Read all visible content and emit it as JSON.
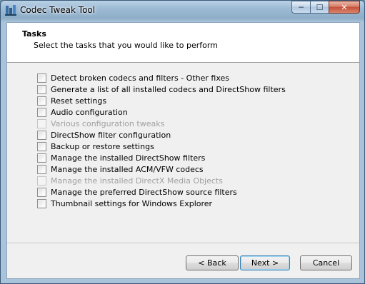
{
  "window": {
    "title": "Codec Tweak Tool",
    "minimize_glyph": "─",
    "maximize_glyph": "☐",
    "close_glyph": "✕"
  },
  "header": {
    "title": "Tasks",
    "subtitle": "Select the tasks that you would like to perform"
  },
  "tasks": [
    {
      "label": "Detect broken codecs and filters  -  Other fixes",
      "checked": false,
      "enabled": true
    },
    {
      "label": "Generate a list of all installed codecs and DirectShow filters",
      "checked": false,
      "enabled": true
    },
    {
      "label": "Reset settings",
      "checked": false,
      "enabled": true
    },
    {
      "label": "Audio configuration",
      "checked": false,
      "enabled": true
    },
    {
      "label": "Various configuration tweaks",
      "checked": false,
      "enabled": false
    },
    {
      "label": "DirectShow filter configuration",
      "checked": false,
      "enabled": true
    },
    {
      "label": "Backup or restore settings",
      "checked": false,
      "enabled": true
    },
    {
      "label": "Manage the installed DirectShow filters",
      "checked": false,
      "enabled": true
    },
    {
      "label": "Manage the installed ACM/VFW codecs",
      "checked": false,
      "enabled": true
    },
    {
      "label": "Manage the installed DirectX Media Objects",
      "checked": false,
      "enabled": false
    },
    {
      "label": "Manage the preferred DirectShow source filters",
      "checked": false,
      "enabled": true
    },
    {
      "label": "Thumbnail settings for Windows Explorer",
      "checked": false,
      "enabled": true
    }
  ],
  "buttons": {
    "back": "< Back",
    "next": "Next >",
    "cancel": "Cancel"
  }
}
